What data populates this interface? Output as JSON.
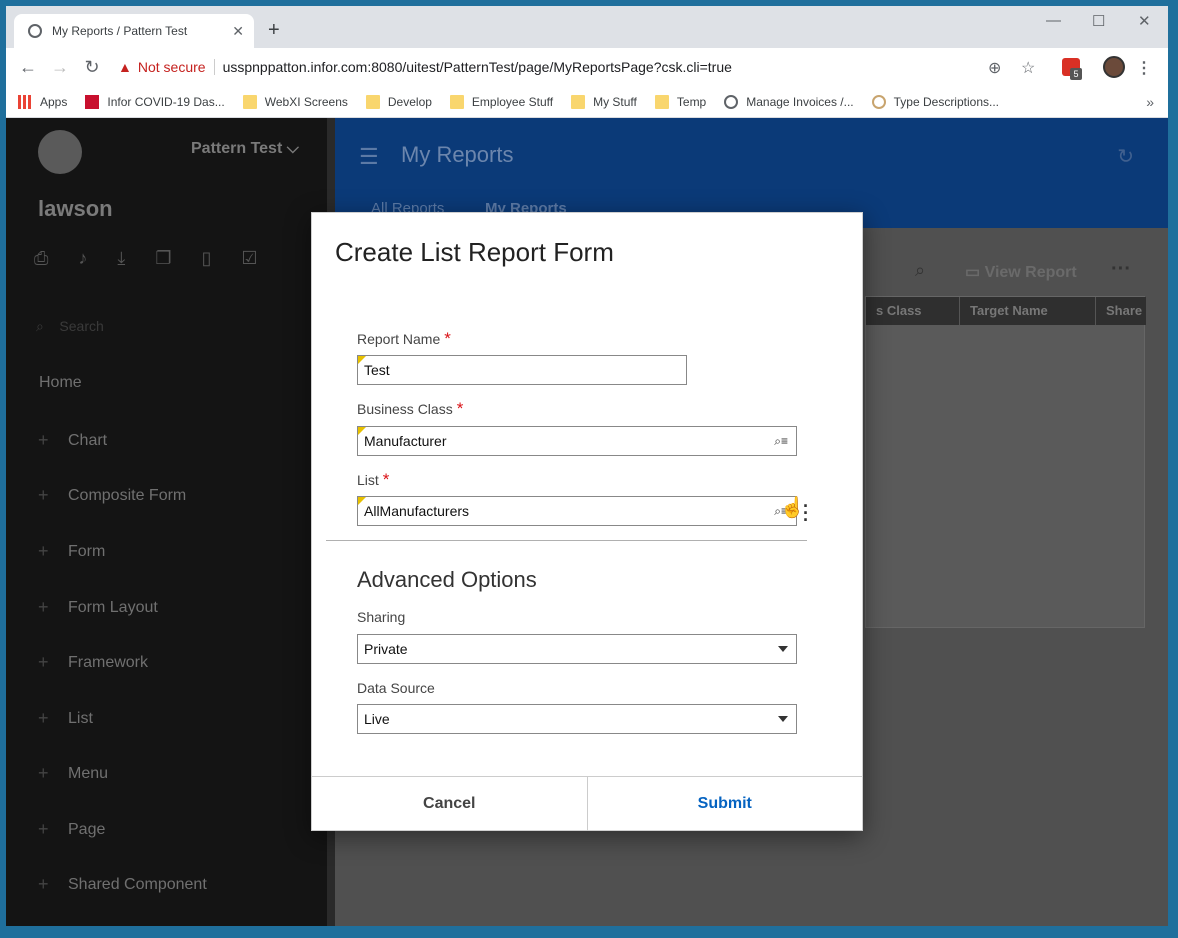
{
  "browser": {
    "tab_title": "My Reports / Pattern Test",
    "new_tab": "+",
    "security_label": "Not secure",
    "url": "usspnppatton.infor.com:8080/uitest/PatternTest/page/MyReportsPage?csk.cli=true",
    "extension_count": "5",
    "bookmarks": [
      "Apps",
      "Infor COVID-19 Das...",
      "WebXI Screens",
      "Develop",
      "Employee Stuff",
      "My Stuff",
      "Temp",
      "Manage Invoices /...",
      "Type Descriptions..."
    ],
    "bookmarks_more": "»"
  },
  "sidebar": {
    "app_menu": "Pattern Test",
    "user": "lawson",
    "search_placeholder": "Search",
    "home": "Home",
    "items": [
      "Chart",
      "Composite Form",
      "Form",
      "Form Layout",
      "Framework",
      "List",
      "Menu",
      "Page",
      "Shared Component"
    ]
  },
  "header": {
    "title": "My Reports",
    "tabs": [
      "All Reports",
      "My Reports"
    ]
  },
  "toolbar": {
    "view_report": "View Report"
  },
  "grid": {
    "columns": [
      "s Class",
      "Target Name",
      "Share"
    ]
  },
  "modal": {
    "title": "Create List Report Form",
    "report_name_label": "Report Name",
    "report_name_value": "Test",
    "business_class_label": "Business Class",
    "business_class_value": "Manufacturer",
    "list_label": "List",
    "list_value": "AllManufacturers",
    "required_mark": "*",
    "advanced_title": "Advanced Options",
    "sharing_label": "Sharing",
    "sharing_value": "Private",
    "data_source_label": "Data Source",
    "data_source_value": "Live",
    "cancel": "Cancel",
    "submit": "Submit"
  },
  "colors": {
    "header_blue": "#0b3a78",
    "required_red": "#da1217",
    "submit_blue": "#0563c1",
    "required_corner": "#e8c100"
  }
}
